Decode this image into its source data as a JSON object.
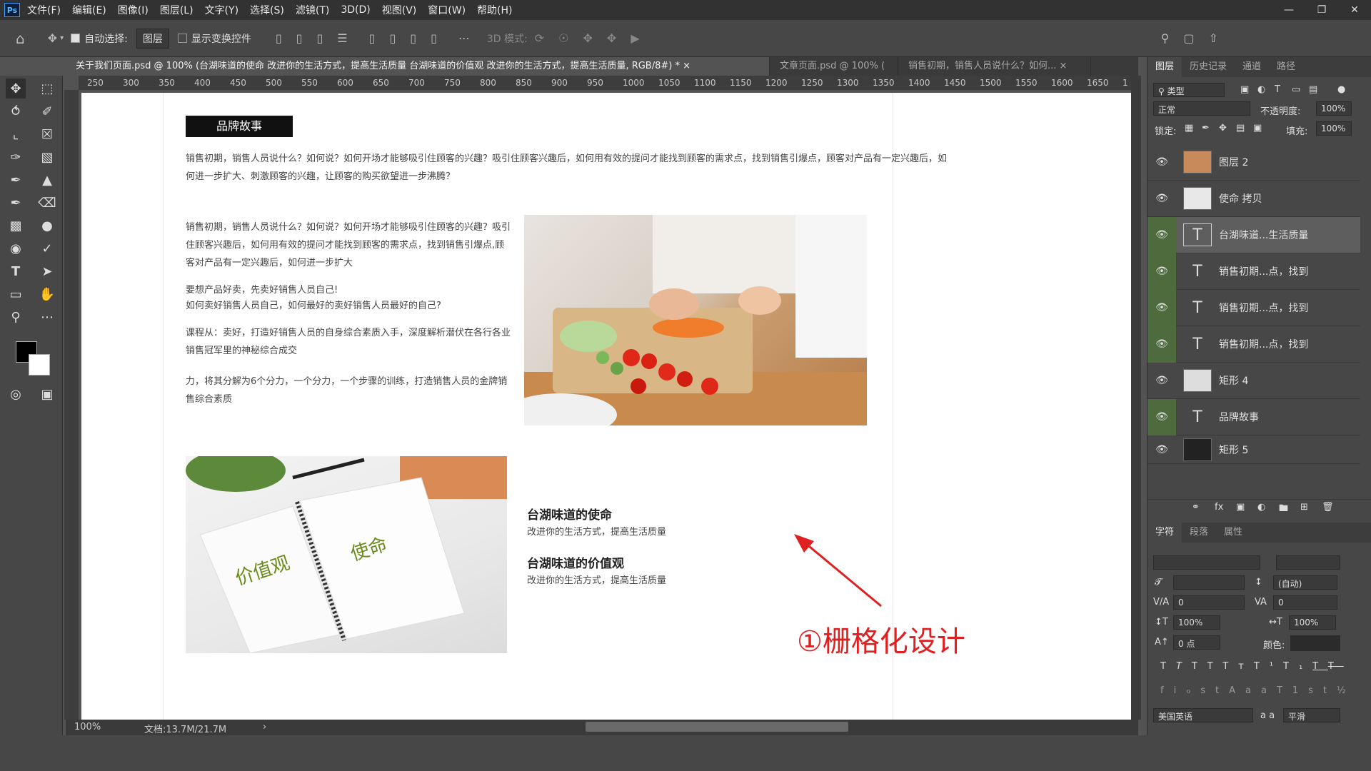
{
  "menu": {
    "logo": "Ps",
    "items": [
      "文件(F)",
      "编辑(E)",
      "图像(I)",
      "图层(L)",
      "文字(Y)",
      "选择(S)",
      "滤镜(T)",
      "3D(D)",
      "视图(V)",
      "窗口(W)",
      "帮助(H)"
    ]
  },
  "options": {
    "auto_select_label": "自动选择:",
    "auto_select_value": "图层",
    "show_transform_label": "显示变换控件",
    "mode_3d": "3D 模式:"
  },
  "tabs": [
    {
      "label": "关于我们页面.psd @ 100% (台湖味道的使命 改进你的生活方式，提高生活质量 台湖味道的价值观 改进你的生活方式，提高生活质量, RGB/8#) *",
      "active": true
    },
    {
      "label": "文章页面.psd @ 100% (",
      "active": false
    },
    {
      "label": "销售初期，销售人员说什么？如何...",
      "active": false
    }
  ],
  "ruler_ticks": [
    "250",
    "300",
    "350",
    "400",
    "450",
    "500",
    "550",
    "600",
    "650",
    "700",
    "750",
    "800",
    "850",
    "900",
    "950",
    "1000",
    "1050",
    "1100",
    "1150",
    "1200",
    "1250",
    "1300",
    "1350",
    "1400",
    "1450",
    "1500",
    "1550",
    "1600",
    "1650",
    "1"
  ],
  "doc": {
    "badge": "品牌故事",
    "intro": "销售初期，销售人员说什么？如何说？如何开场才能够吸引住顾客的兴趣？吸引住顾客兴趣后，如何用有效的提问才能找到顾客的需求点，找到销售引爆点，顾客对产品有一定兴趣后，如何进一步扩大、刺激顾客的兴趣，让顾客的购买欲望进一步沸腾？",
    "para1": "销售初期，销售人员说什么？如何说？如何开场才能够吸引住顾客的兴趣？吸引住顾客兴趣后，如何用有效的提问才能找到顾客的需求点，找到销售引爆点,顾客对产品有一定兴趣后，如何进一步扩大",
    "para2a": "要想产品好卖，先卖好销售人员自己!",
    "para2b": "如何卖好销售人员自己，如何最好的卖好销售人员最好的自己?",
    "para3": "课程从：卖好，打造好销售人员的自身综合素质入手，深度解析潜伏在各行各业销售冠军里的神秘综合成交",
    "para4": "力，将其分解为6个分力，一个分力，一个步骤的训练，打造销售人员的金牌销售综合素质",
    "notebook_left": "价值观",
    "notebook_right": "使命",
    "mission_title": "台湖味道的使命",
    "mission_sub": "改进你的生活方式，提高生活质量",
    "values_title": "台湖味道的价值观",
    "values_sub": "改进你的生活方式，提高生活质量"
  },
  "annotation": "①栅格化设计",
  "status": {
    "zoom": "100%",
    "doc": "文档:13.7M/21.7M"
  },
  "panel_tabs": [
    "图层",
    "历史记录",
    "通道",
    "路径"
  ],
  "layer_filter": "类型",
  "blend": {
    "mode": "正常",
    "opacity_label": "不透明度:",
    "opacity": "100%",
    "lock_label": "锁定:",
    "fill_label": "填充:",
    "fill": "100%"
  },
  "layers": [
    {
      "name": "图层 2",
      "type": "image",
      "linked": false
    },
    {
      "name": "使命 拷贝",
      "type": "image",
      "linked": false
    },
    {
      "name": "台湖味道...生活质量",
      "type": "text",
      "linked": true,
      "selected": true
    },
    {
      "name": "销售初期...点，找到",
      "type": "text",
      "linked": true
    },
    {
      "name": "销售初期...点，找到",
      "type": "text",
      "linked": true
    },
    {
      "name": "销售初期...点，找到",
      "type": "text",
      "linked": true
    },
    {
      "name": "矩形 4",
      "type": "shape",
      "linked": false
    },
    {
      "name": "品牌故事",
      "type": "text",
      "linked": true
    },
    {
      "name": "矩形 5",
      "type": "shape",
      "linked": false
    }
  ],
  "char_tabs": [
    "字符",
    "段落",
    "属性"
  ],
  "char": {
    "leading": "(自动)",
    "kern": "0",
    "track": "0",
    "vscale": "100%",
    "hscale": "100%",
    "baseline": "0 点",
    "color_label": "颜色:",
    "lang": "美国英语",
    "aa_label": "a a",
    "aa": "平滑"
  }
}
